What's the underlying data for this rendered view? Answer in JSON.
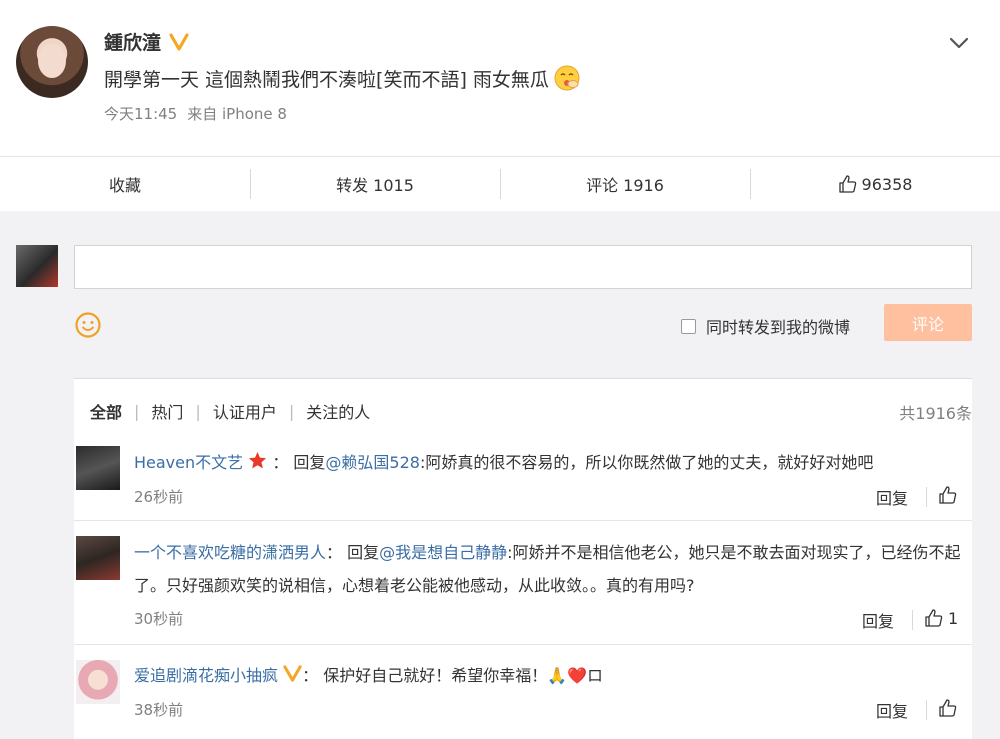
{
  "post": {
    "author": "鍾欣潼",
    "text": "開學第一天 這個熱鬧我們不湊啦[笑而不語] 雨女無瓜",
    "time": "今天11:45",
    "source": "来自 iPhone 8"
  },
  "actions": {
    "favorite": "收藏",
    "repost": "转发 1015",
    "comment": "评论 1916",
    "likes": "96358"
  },
  "composer": {
    "placeholder": "",
    "repost_label": "同时转发到我的微博",
    "submit_label": "评论"
  },
  "comments": {
    "filters": [
      "全部",
      "热门",
      "认证用户",
      "关注的人"
    ],
    "total": "共1916条",
    "items": [
      {
        "user": "Heaven不文艺",
        "prefix": "：  回复",
        "mention": "@赖弘国528",
        "text": ":阿娇真的很不容易的，所以你既然做了她的丈夫，就好好对她吧",
        "time": "26秒前",
        "reply": "回复",
        "likes": ""
      },
      {
        "user": "一个不喜欢吃糖的潇洒男人",
        "prefix": "：  回复",
        "mention": "@我是想自己静静",
        "text": ":阿娇并不是相信他老公，她只是不敢去面对现实了，已经伤不起了。只好强颜欢笑的说相信，心想着老公能被他感动，从此收敛。。真的有用吗?",
        "time": "30秒前",
        "reply": "回复",
        "likes": "1"
      },
      {
        "user": "爱追剧滴花痴小抽疯",
        "prefix": "：  ",
        "mention": "",
        "text": "保护好自己就好！希望你幸福！🙏❤️ロ",
        "time": "38秒前",
        "reply": "回复",
        "likes": ""
      }
    ]
  },
  "colors": {
    "link": "#3a6ea5",
    "verified": "#f5a623",
    "submit_bg": "#ffc09f",
    "star": "#e8392b"
  },
  "icons": [
    "verified-icon",
    "chevron-down-icon",
    "emoji-icon",
    "thumbs-up-icon",
    "smiley-icon",
    "star-icon",
    "vip-icon"
  ]
}
